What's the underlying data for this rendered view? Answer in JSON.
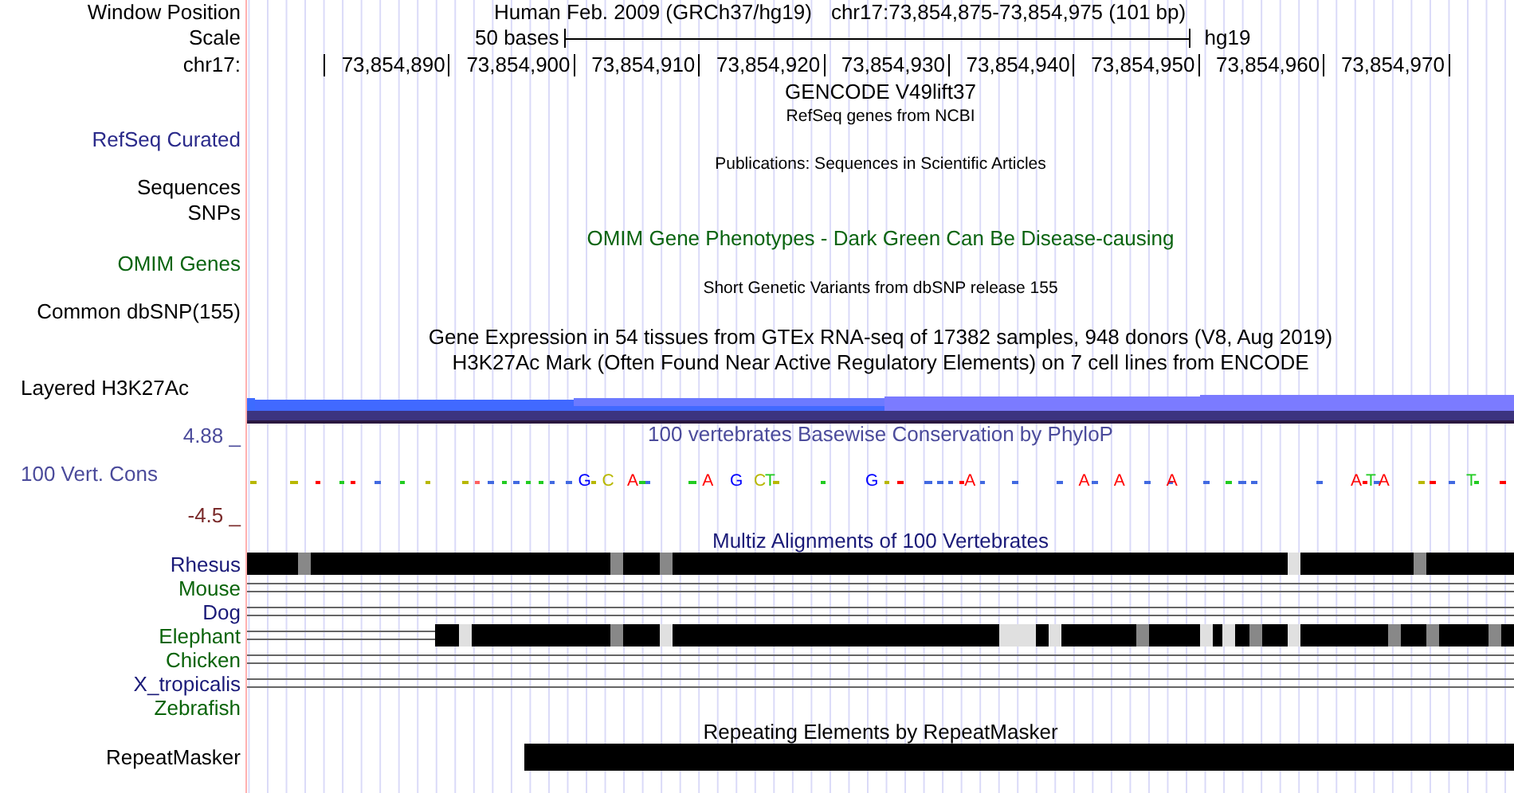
{
  "header": {
    "label": "Window Position",
    "assembly": "Human Feb. 2009 (GRCh37/hg19)",
    "position": "chr17:73,854,875-73,854,975 (101 bp)"
  },
  "scale": {
    "label": "Scale",
    "length": "50 bases",
    "db": "hg19"
  },
  "ruler": {
    "label": "chr17:",
    "ticks": [
      "73,854,890",
      "73,854,900",
      "73,854,910",
      "73,854,920",
      "73,854,930",
      "73,854,940",
      "73,854,950",
      "73,854,960",
      "73,854,970"
    ]
  },
  "rows": [
    {
      "kind": "caption",
      "text": "GENCODE V49lift37",
      "color": "#000000"
    },
    {
      "kind": "note",
      "text": "RefSeq genes from NCBI"
    },
    {
      "kind": "label",
      "text": "RefSeq Curated",
      "color": "#2a2a8a"
    },
    {
      "kind": "note",
      "text": "Publications: Sequences in Scientific Articles"
    },
    {
      "kind": "label",
      "text": "Sequences",
      "color": "#000000"
    },
    {
      "kind": "label",
      "text": "SNPs",
      "color": "#000000"
    },
    {
      "kind": "caption",
      "text": "OMIM Gene Phenotypes - Dark Green Can Be Disease-causing",
      "color": "#0a6410"
    },
    {
      "kind": "label",
      "text": "OMIM Genes",
      "color": "#0a6410"
    },
    {
      "kind": "note",
      "text": "Short Genetic Variants from dbSNP release 155"
    },
    {
      "kind": "label",
      "text": "Common dbSNP(155)",
      "color": "#000000"
    },
    {
      "kind": "caption",
      "text": "Gene Expression in 54 tissues from GTEx RNA-seq of 17382 samples, 948 donors (V8, Aug 2019)",
      "color": "#000000"
    },
    {
      "kind": "caption",
      "text": "H3K27Ac Mark (Often Found Near Active Regulatory Elements) on 7 cell lines from ENCODE",
      "color": "#000000"
    },
    {
      "kind": "signal",
      "label": "Layered H3K27Ac"
    },
    {
      "kind": "conservation",
      "top": "4.88 _",
      "title": "100 vertebrates Basewise Conservation by PhyloP",
      "label": "100 Vert. Cons",
      "bottom": "-4.5 _",
      "letters": [
        {
          "letter": "G",
          "color": "#0000ff"
        },
        {
          "letter": "C",
          "color": "#b8b800"
        },
        {
          "letter": "A",
          "color": "#ff0000"
        },
        {
          "letter": "A",
          "color": "#ff0000"
        },
        {
          "letter": "G",
          "color": "#0000ff"
        },
        {
          "letter": "C",
          "color": "#b8b800"
        },
        {
          "letter": "T",
          "color": "#22cc22"
        },
        {
          "letter": "G",
          "color": "#0000ff"
        },
        {
          "letter": "A",
          "color": "#ff0000"
        },
        {
          "letter": "A",
          "color": "#ff0000"
        },
        {
          "letter": "A",
          "color": "#ff0000"
        },
        {
          "letter": "A",
          "color": "#ff0000"
        },
        {
          "letter": "A",
          "color": "#ff0000"
        },
        {
          "letter": "T",
          "color": "#22cc22"
        },
        {
          "letter": "A",
          "color": "#ff0000"
        },
        {
          "letter": "T",
          "color": "#22cc22"
        }
      ]
    },
    {
      "kind": "multiz",
      "title": "Multiz Alignments of 100 Vertebrates",
      "species": [
        {
          "name": "Rhesus",
          "color": "#1a1a78",
          "kind": "blocks"
        },
        {
          "name": "Mouse",
          "color": "#0a640a",
          "kind": "lines"
        },
        {
          "name": "Dog",
          "color": "#1a1a78",
          "kind": "lines"
        },
        {
          "name": "Elephant",
          "color": "#0a640a",
          "kind": "blocks"
        },
        {
          "name": "Chicken",
          "color": "#0a640a",
          "kind": "lines"
        },
        {
          "name": "X_tropicalis",
          "color": "#1a1a78",
          "kind": "lines"
        },
        {
          "name": "Zebrafish",
          "color": "#0a640a",
          "kind": "none"
        }
      ]
    },
    {
      "kind": "repeats",
      "title": "Repeating Elements by RepeatMasker",
      "label": "RepeatMasker"
    }
  ]
}
